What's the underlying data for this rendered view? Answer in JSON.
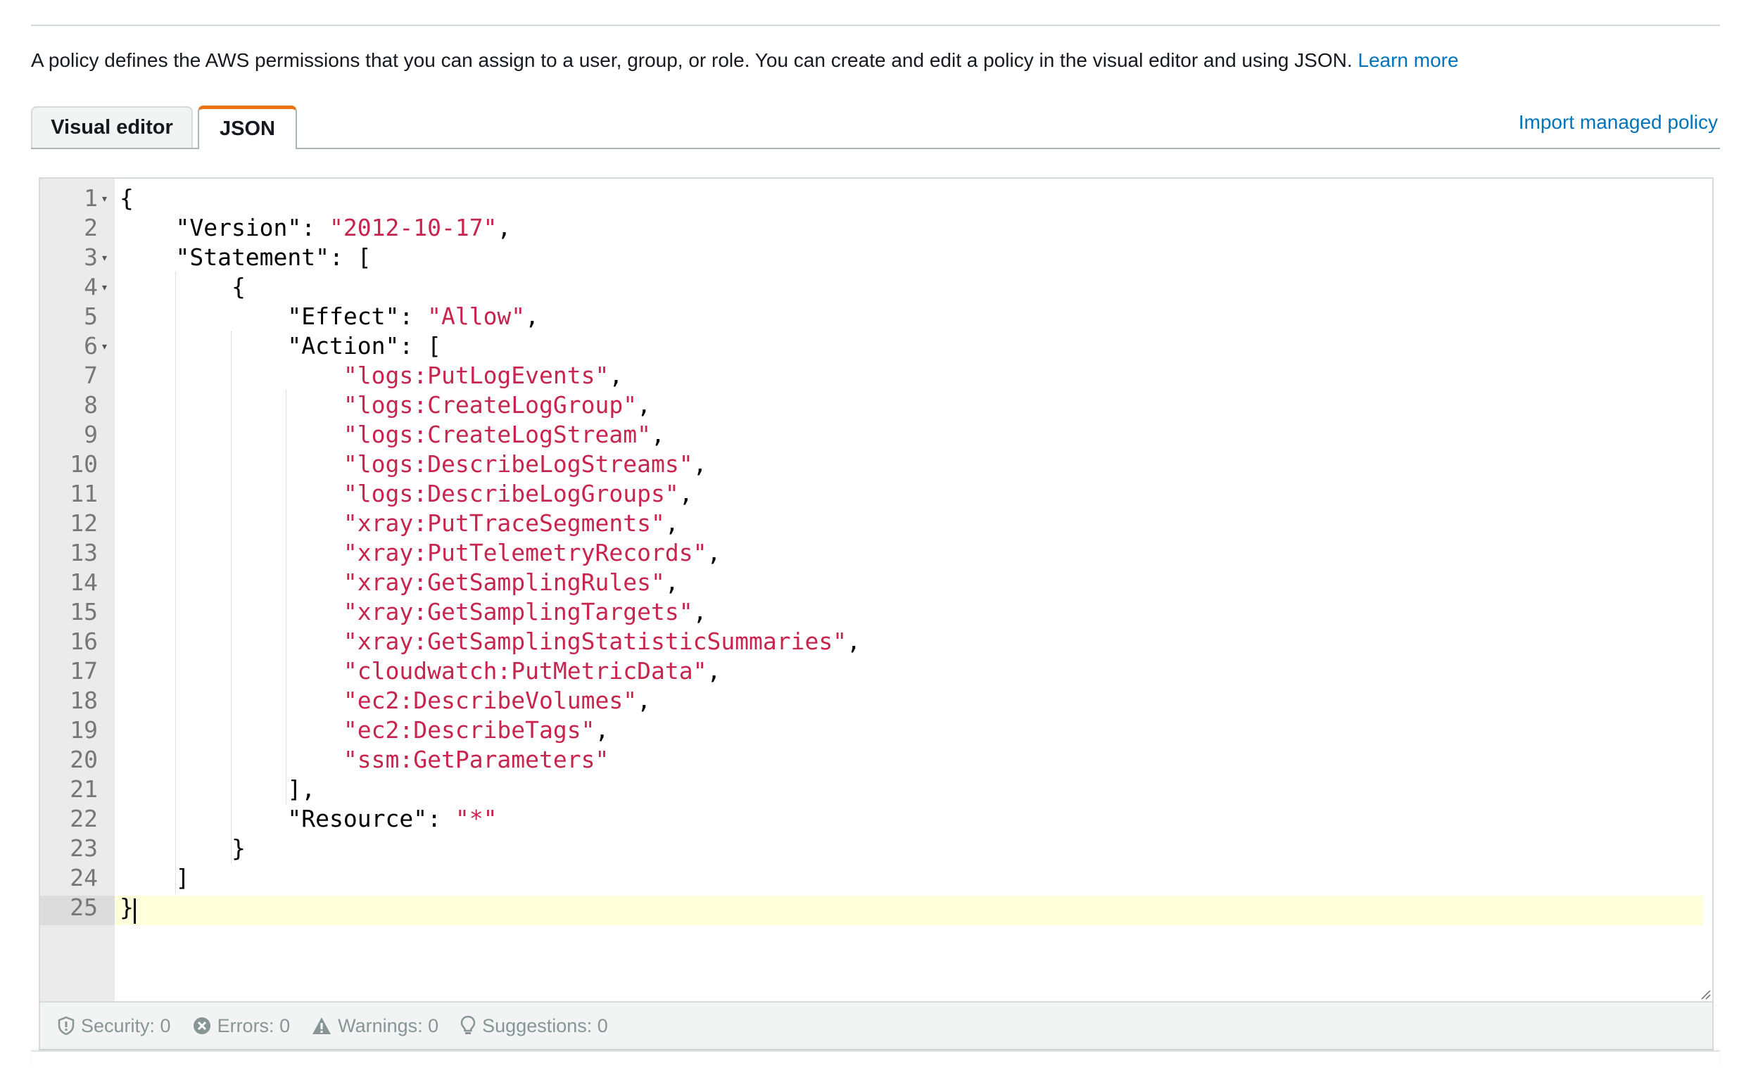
{
  "description": {
    "text": "A policy defines the AWS permissions that you can assign to a user, group, or role. You can create and edit a policy in the visual editor and using JSON. ",
    "link": "Learn more"
  },
  "tabs": [
    {
      "label": "Visual editor",
      "active": false
    },
    {
      "label": "JSON",
      "active": true
    }
  ],
  "import_link": "Import managed policy",
  "editor": {
    "active_line": 25,
    "lines": [
      {
        "n": "1",
        "fold": true,
        "tokens": [
          [
            "p",
            "{"
          ]
        ]
      },
      {
        "n": "2",
        "fold": false,
        "tokens": [
          [
            "p",
            "    \"Version\": "
          ],
          [
            "s",
            "\"2012-10-17\""
          ],
          [
            "p",
            ","
          ]
        ]
      },
      {
        "n": "3",
        "fold": true,
        "tokens": [
          [
            "p",
            "    \"Statement\": ["
          ]
        ]
      },
      {
        "n": "4",
        "fold": true,
        "tokens": [
          [
            "p",
            "        {"
          ]
        ]
      },
      {
        "n": "5",
        "fold": false,
        "tokens": [
          [
            "p",
            "            \"Effect\": "
          ],
          [
            "s",
            "\"Allow\""
          ],
          [
            "p",
            ","
          ]
        ]
      },
      {
        "n": "6",
        "fold": true,
        "tokens": [
          [
            "p",
            "            \"Action\": ["
          ]
        ]
      },
      {
        "n": "7",
        "fold": false,
        "tokens": [
          [
            "p",
            "                "
          ],
          [
            "s",
            "\"logs:PutLogEvents\""
          ],
          [
            "p",
            ","
          ]
        ]
      },
      {
        "n": "8",
        "fold": false,
        "tokens": [
          [
            "p",
            "                "
          ],
          [
            "s",
            "\"logs:CreateLogGroup\""
          ],
          [
            "p",
            ","
          ]
        ]
      },
      {
        "n": "9",
        "fold": false,
        "tokens": [
          [
            "p",
            "                "
          ],
          [
            "s",
            "\"logs:CreateLogStream\""
          ],
          [
            "p",
            ","
          ]
        ]
      },
      {
        "n": "10",
        "fold": false,
        "tokens": [
          [
            "p",
            "                "
          ],
          [
            "s",
            "\"logs:DescribeLogStreams\""
          ],
          [
            "p",
            ","
          ]
        ]
      },
      {
        "n": "11",
        "fold": false,
        "tokens": [
          [
            "p",
            "                "
          ],
          [
            "s",
            "\"logs:DescribeLogGroups\""
          ],
          [
            "p",
            ","
          ]
        ]
      },
      {
        "n": "12",
        "fold": false,
        "tokens": [
          [
            "p",
            "                "
          ],
          [
            "s",
            "\"xray:PutTraceSegments\""
          ],
          [
            "p",
            ","
          ]
        ]
      },
      {
        "n": "13",
        "fold": false,
        "tokens": [
          [
            "p",
            "                "
          ],
          [
            "s",
            "\"xray:PutTelemetryRecords\""
          ],
          [
            "p",
            ","
          ]
        ]
      },
      {
        "n": "14",
        "fold": false,
        "tokens": [
          [
            "p",
            "                "
          ],
          [
            "s",
            "\"xray:GetSamplingRules\""
          ],
          [
            "p",
            ","
          ]
        ]
      },
      {
        "n": "15",
        "fold": false,
        "tokens": [
          [
            "p",
            "                "
          ],
          [
            "s",
            "\"xray:GetSamplingTargets\""
          ],
          [
            "p",
            ","
          ]
        ]
      },
      {
        "n": "16",
        "fold": false,
        "tokens": [
          [
            "p",
            "                "
          ],
          [
            "s",
            "\"xray:GetSamplingStatisticSummaries\""
          ],
          [
            "p",
            ","
          ]
        ]
      },
      {
        "n": "17",
        "fold": false,
        "tokens": [
          [
            "p",
            "                "
          ],
          [
            "s",
            "\"cloudwatch:PutMetricData\""
          ],
          [
            "p",
            ","
          ]
        ]
      },
      {
        "n": "18",
        "fold": false,
        "tokens": [
          [
            "p",
            "                "
          ],
          [
            "s",
            "\"ec2:DescribeVolumes\""
          ],
          [
            "p",
            ","
          ]
        ]
      },
      {
        "n": "19",
        "fold": false,
        "tokens": [
          [
            "p",
            "                "
          ],
          [
            "s",
            "\"ec2:DescribeTags\""
          ],
          [
            "p",
            ","
          ]
        ]
      },
      {
        "n": "20",
        "fold": false,
        "tokens": [
          [
            "p",
            "                "
          ],
          [
            "s",
            "\"ssm:GetParameters\""
          ]
        ]
      },
      {
        "n": "21",
        "fold": false,
        "tokens": [
          [
            "p",
            "            ],"
          ]
        ]
      },
      {
        "n": "22",
        "fold": false,
        "tokens": [
          [
            "p",
            "            \"Resource\": "
          ],
          [
            "s",
            "\"*\""
          ]
        ]
      },
      {
        "n": "23",
        "fold": false,
        "tokens": [
          [
            "p",
            "        }"
          ]
        ]
      },
      {
        "n": "24",
        "fold": false,
        "tokens": [
          [
            "p",
            "    ]"
          ]
        ]
      },
      {
        "n": "25",
        "fold": false,
        "tokens": [
          [
            "p",
            "}"
          ]
        ]
      }
    ]
  },
  "status": {
    "security": "Security: 0",
    "errors": "Errors: 0",
    "warnings": "Warnings: 0",
    "suggestions": "Suggestions: 0"
  },
  "colors": {
    "string": "#c7254e",
    "link": "#0073bb",
    "active_tab_accent": "#ec7211"
  }
}
